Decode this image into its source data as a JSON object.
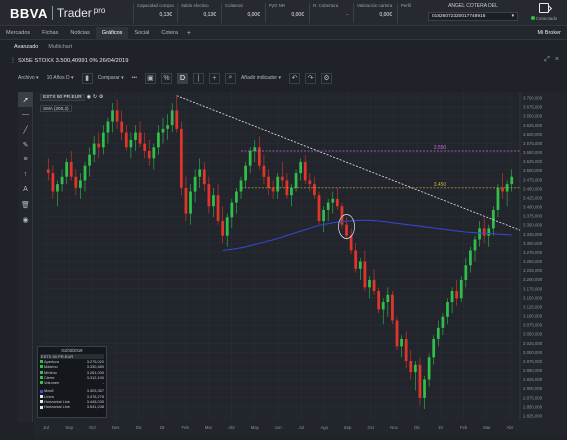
{
  "header": {
    "brand": "BBVA",
    "product": "Trader",
    "edition": "pro",
    "stats": [
      {
        "label": "Capacidad compra",
        "value": "0,13€"
      },
      {
        "label": "Saldo efectivo",
        "value": "0,13€"
      },
      {
        "label": "Colateral",
        "value": "0,00€"
      },
      {
        "label": "PyG NR",
        "value": "0,00€"
      },
      {
        "label": "R. Cobertura",
        "value": "-"
      },
      {
        "label": "Valoración cartera",
        "value": "0,00€"
      },
      {
        "label": "Perfil",
        "value": "P0"
      }
    ],
    "account_name": "ANGEL COTERA DEL",
    "account_number": "01826072320017748918",
    "connection_status": "Conectado",
    "colors": {
      "connected": "#2fbf4a"
    }
  },
  "nav": {
    "items": [
      "Mercados",
      "Fichas",
      "Noticias",
      "Gráficos",
      "Social",
      "Cotera"
    ],
    "active": "Gráficos",
    "add_label": "+",
    "right_label": "Mi Broker"
  },
  "subnav": {
    "items": [
      "Avanzado",
      "Multichart"
    ],
    "active": "Avanzado"
  },
  "symbol_line": "SX5E STOXX 3.500,40991 0% 26/04/2019",
  "toolbar": {
    "archivo": "Archivo ▾",
    "period": "10 Años D ▾",
    "compare": "Comparar ▾",
    "add_indicator": "Añadir indicador ▾"
  },
  "legend": {
    "symbol_label": "ESTX 50 PR.EUR",
    "sma_label": "SMA (200,2)"
  },
  "info_panel": {
    "date": "01/03/2019",
    "symbol": "ESTX 50 PR.EUR",
    "rows": [
      {
        "label": "Apertura",
        "value": "3.275,020",
        "color": "#2fbf4a"
      },
      {
        "label": "Máximo",
        "value": "3.330,480",
        "color": "#2fbf4a"
      },
      {
        "label": "Mínimo",
        "value": "3.261,030",
        "color": "#2fbf4a"
      },
      {
        "label": "Cierre",
        "value": "3.312,100",
        "color": "#2fbf4a"
      },
      {
        "label": "Volumen",
        "value": "-",
        "color": "#2fbf4a"
      }
    ],
    "rows2": [
      {
        "label": "Mov8",
        "value": "3.303,357",
        "color": "#3d4fd6"
      },
      {
        "label": "Línea",
        "value": "3.376,278",
        "color": "#e6e8eb"
      },
      {
        "label": "Horizontal Line",
        "value": "3.445,035",
        "color": "#e6e8eb"
      },
      {
        "label": "Horizontal Line",
        "value": "3.541,248",
        "color": "#e6e8eb"
      }
    ]
  },
  "chart_data": {
    "type": "candlestick",
    "symbol": "SX5E",
    "y_ticks": [
      "3.700,000",
      "3.675,000",
      "3.650,000",
      "3.625,000",
      "3.600,000",
      "3.575,000",
      "3.550,000",
      "3.525,000",
      "3.500,000",
      "3.475,000",
      "3.450,000",
      "3.425,000",
      "3.400,000",
      "3.375,000",
      "3.350,000",
      "3.325,000",
      "3.300,000",
      "3.275,000",
      "3.250,000",
      "3.225,000",
      "3.200,000",
      "3.175,000",
      "3.150,000",
      "3.125,000",
      "3.100,000",
      "3.075,000",
      "3.050,000",
      "3.025,000",
      "3.000,000",
      "2.975,000",
      "2.950,000",
      "2.925,000",
      "2.900,000",
      "2.875,000",
      "2.850,000",
      "2.825,000"
    ],
    "x_ticks": [
      "Jul",
      "Sep",
      "Oct",
      "Nov",
      "Dic",
      "18",
      "Feb",
      "Mar",
      "Abr",
      "May",
      "Jun",
      "Jul",
      "Ago",
      "Sep",
      "Oct",
      "Nov",
      "Dic",
      "19",
      "Feb",
      "Mar",
      "Abr"
    ],
    "ylim": [
      2820,
      3710
    ],
    "horizontal_lines": [
      {
        "label": "3.550",
        "value": 3550,
        "color": "#c86ad8"
      },
      {
        "label": "3.450",
        "value": 3450,
        "color": "#c9b23a"
      }
    ],
    "candles": [
      [
        3500,
        3530,
        3470,
        3490
      ],
      [
        3490,
        3510,
        3420,
        3440
      ],
      [
        3440,
        3470,
        3400,
        3460
      ],
      [
        3460,
        3500,
        3440,
        3480
      ],
      [
        3480,
        3530,
        3460,
        3520
      ],
      [
        3520,
        3550,
        3470,
        3480
      ],
      [
        3480,
        3500,
        3430,
        3450
      ],
      [
        3450,
        3490,
        3420,
        3470
      ],
      [
        3470,
        3520,
        3440,
        3510
      ],
      [
        3510,
        3560,
        3480,
        3540
      ],
      [
        3540,
        3590,
        3520,
        3570
      ],
      [
        3570,
        3600,
        3530,
        3560
      ],
      [
        3560,
        3620,
        3540,
        3600
      ],
      [
        3600,
        3640,
        3570,
        3630
      ],
      [
        3630,
        3680,
        3600,
        3660
      ],
      [
        3660,
        3690,
        3610,
        3630
      ],
      [
        3630,
        3660,
        3580,
        3600
      ],
      [
        3600,
        3620,
        3550,
        3560
      ],
      [
        3560,
        3600,
        3530,
        3580
      ],
      [
        3580,
        3620,
        3550,
        3600
      ],
      [
        3600,
        3630,
        3560,
        3570
      ],
      [
        3570,
        3600,
        3530,
        3550
      ],
      [
        3550,
        3580,
        3510,
        3530
      ],
      [
        3530,
        3570,
        3500,
        3560
      ],
      [
        3560,
        3620,
        3540,
        3600
      ],
      [
        3600,
        3640,
        3570,
        3610
      ],
      [
        3610,
        3650,
        3580,
        3620
      ],
      [
        3620,
        3680,
        3600,
        3660
      ],
      [
        3660,
        3700,
        3600,
        3610
      ],
      [
        3610,
        3630,
        3430,
        3450
      ],
      [
        3450,
        3480,
        3360,
        3380
      ],
      [
        3380,
        3460,
        3350,
        3440
      ],
      [
        3440,
        3500,
        3410,
        3480
      ],
      [
        3480,
        3530,
        3450,
        3500
      ],
      [
        3500,
        3520,
        3440,
        3460
      ],
      [
        3460,
        3480,
        3380,
        3400
      ],
      [
        3400,
        3450,
        3370,
        3430
      ],
      [
        3430,
        3460,
        3350,
        3360
      ],
      [
        3360,
        3400,
        3300,
        3320
      ],
      [
        3320,
        3380,
        3290,
        3370
      ],
      [
        3370,
        3420,
        3340,
        3410
      ],
      [
        3410,
        3450,
        3380,
        3440
      ],
      [
        3440,
        3480,
        3420,
        3470
      ],
      [
        3470,
        3520,
        3450,
        3510
      ],
      [
        3510,
        3560,
        3490,
        3550
      ],
      [
        3550,
        3580,
        3520,
        3560
      ],
      [
        3560,
        3590,
        3500,
        3510
      ],
      [
        3510,
        3540,
        3460,
        3480
      ],
      [
        3480,
        3500,
        3430,
        3450
      ],
      [
        3450,
        3470,
        3420,
        3440
      ],
      [
        3440,
        3490,
        3420,
        3480
      ],
      [
        3480,
        3520,
        3450,
        3470
      ],
      [
        3470,
        3490,
        3420,
        3430
      ],
      [
        3430,
        3460,
        3400,
        3450
      ],
      [
        3450,
        3500,
        3440,
        3490
      ],
      [
        3490,
        3530,
        3470,
        3520
      ],
      [
        3520,
        3540,
        3460,
        3470
      ],
      [
        3470,
        3490,
        3440,
        3460
      ],
      [
        3460,
        3480,
        3420,
        3430
      ],
      [
        3430,
        3440,
        3350,
        3360
      ],
      [
        3360,
        3400,
        3330,
        3390
      ],
      [
        3390,
        3420,
        3360,
        3410
      ],
      [
        3410,
        3440,
        3380,
        3420
      ],
      [
        3420,
        3450,
        3390,
        3400
      ],
      [
        3400,
        3410,
        3340,
        3350
      ],
      [
        3350,
        3370,
        3310,
        3320
      ],
      [
        3320,
        3340,
        3270,
        3280
      ],
      [
        3280,
        3300,
        3220,
        3230
      ],
      [
        3230,
        3260,
        3200,
        3250
      ],
      [
        3250,
        3280,
        3170,
        3180
      ],
      [
        3180,
        3210,
        3150,
        3200
      ],
      [
        3200,
        3230,
        3160,
        3170
      ],
      [
        3170,
        3180,
        3110,
        3120
      ],
      [
        3120,
        3150,
        3080,
        3140
      ],
      [
        3140,
        3180,
        3100,
        3160
      ],
      [
        3160,
        3170,
        3080,
        3090
      ],
      [
        3090,
        3100,
        3010,
        3020
      ],
      [
        3020,
        3050,
        2990,
        3040
      ],
      [
        3040,
        3060,
        2960,
        2980
      ],
      [
        2980,
        3010,
        2930,
        2950
      ],
      [
        2950,
        2980,
        2900,
        2970
      ],
      [
        2970,
        2990,
        2860,
        2880
      ],
      [
        2880,
        2940,
        2850,
        2930
      ],
      [
        2930,
        3000,
        2910,
        2990
      ],
      [
        2990,
        3050,
        2970,
        3040
      ],
      [
        3040,
        3090,
        3020,
        3070
      ],
      [
        3070,
        3110,
        3050,
        3100
      ],
      [
        3100,
        3150,
        3080,
        3140
      ],
      [
        3140,
        3180,
        3110,
        3170
      ],
      [
        3170,
        3200,
        3130,
        3150
      ],
      [
        3150,
        3210,
        3140,
        3200
      ],
      [
        3200,
        3260,
        3180,
        3240
      ],
      [
        3240,
        3290,
        3220,
        3280
      ],
      [
        3280,
        3320,
        3250,
        3310
      ],
      [
        3310,
        3360,
        3290,
        3340
      ],
      [
        3340,
        3370,
        3300,
        3320
      ],
      [
        3320,
        3350,
        3290,
        3340
      ],
      [
        3340,
        3400,
        3320,
        3390
      ],
      [
        3390,
        3460,
        3370,
        3450
      ],
      [
        3450,
        3490,
        3420,
        3440
      ],
      [
        3440,
        3470,
        3400,
        3460
      ],
      [
        3460,
        3500,
        3440,
        3480
      ]
    ],
    "sma": [
      3280,
      3282,
      3284,
      3287,
      3290,
      3294,
      3298,
      3302,
      3306,
      3310,
      3315,
      3320,
      3325,
      3330,
      3335,
      3340,
      3345,
      3349,
      3352,
      3355,
      3357,
      3359,
      3360,
      3361,
      3362,
      3362,
      3361,
      3360,
      3358,
      3356,
      3354,
      3352,
      3350,
      3348,
      3346,
      3344,
      3342,
      3340,
      3338,
      3336,
      3334,
      3332,
      3330,
      3329,
      3328,
      3327,
      3326,
      3325,
      3324,
      3323,
      3322
    ]
  }
}
